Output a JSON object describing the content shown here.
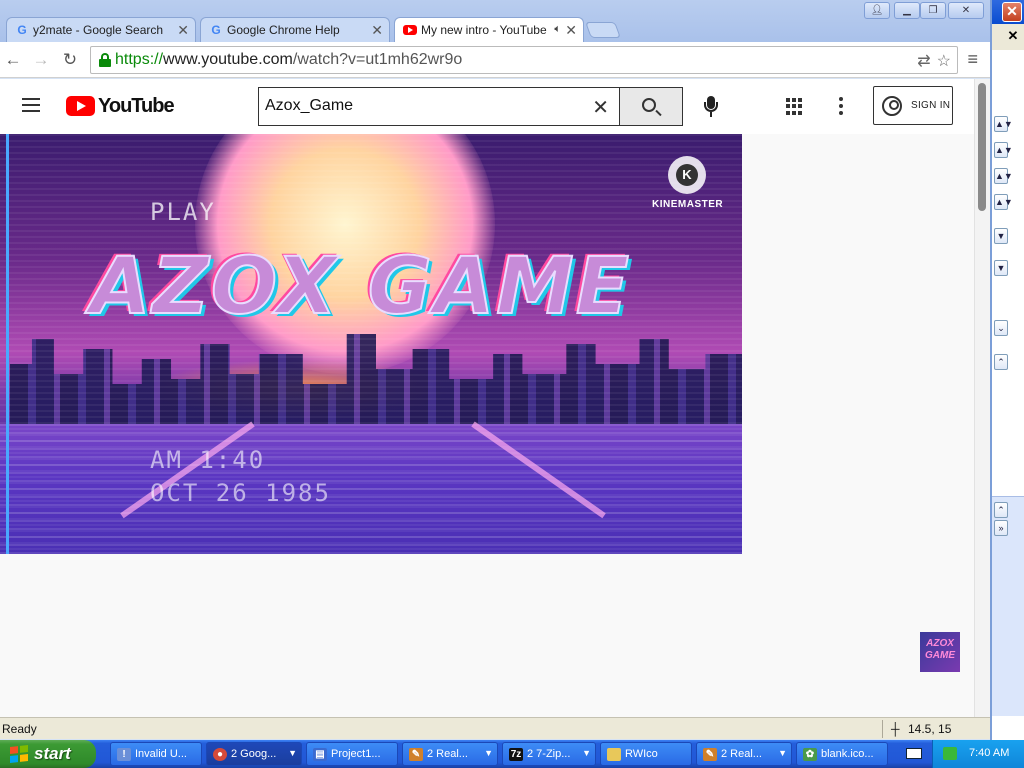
{
  "browser": {
    "tabs": [
      {
        "title": "y2mate - Google Search",
        "icon": "google-icon",
        "active": false
      },
      {
        "title": "Google Chrome Help",
        "icon": "google-icon",
        "active": false
      },
      {
        "title": "My new intro - YouTube",
        "icon": "youtube-icon",
        "active": true,
        "audio": true
      }
    ],
    "url": {
      "scheme": "https://",
      "host": "www.youtube.com",
      "path": "/watch?v=ut1mh62wr9o"
    }
  },
  "youtube": {
    "logo_text": "YouTube",
    "search_value": "Azox_Game",
    "clear_glyph": "✕",
    "signin_label": "SIGN IN"
  },
  "video": {
    "play_text": "PLAY ",
    "title_text": "AZOX GAME",
    "timestamp_line1": "AM 1:40",
    "timestamp_line2": "OCT 26 1985",
    "watermark_label": "KINEMASTER",
    "channel_mark": "AZOX GAME"
  },
  "statusbar": {
    "status_text": "Ready",
    "coords_text": "14.5, 15"
  },
  "taskbar": {
    "start_label": "start",
    "tasks": [
      {
        "label": "Invalid U...",
        "icon": "warning-window-icon",
        "color": "#6a8fd8"
      },
      {
        "label": "2 Goog...",
        "icon": "chrome-icon",
        "color": "#d44a3a",
        "active": true
      },
      {
        "label": "Project1...",
        "icon": "vb-project-icon",
        "color": "#3a6ad0"
      },
      {
        "label": "2 Real...",
        "icon": "realworld-icon",
        "color": "#d0802a"
      },
      {
        "label": "2 7-Zip...",
        "icon": "7zip-icon",
        "color": "#111111"
      },
      {
        "label": "RWIco",
        "icon": "folder-icon",
        "color": "#e8c85a"
      },
      {
        "label": "2 Real...",
        "icon": "realworld-icon",
        "color": "#d0802a"
      },
      {
        "label": "blank.ico...",
        "icon": "paint-icon",
        "color": "#4a9a4a"
      }
    ],
    "clock": "7:40 AM"
  },
  "colors": {
    "youtube_red": "#ff0000",
    "xp_blue": "#245edb",
    "start_green": "#3c9a34",
    "secure_green": "#0a8a0a"
  }
}
